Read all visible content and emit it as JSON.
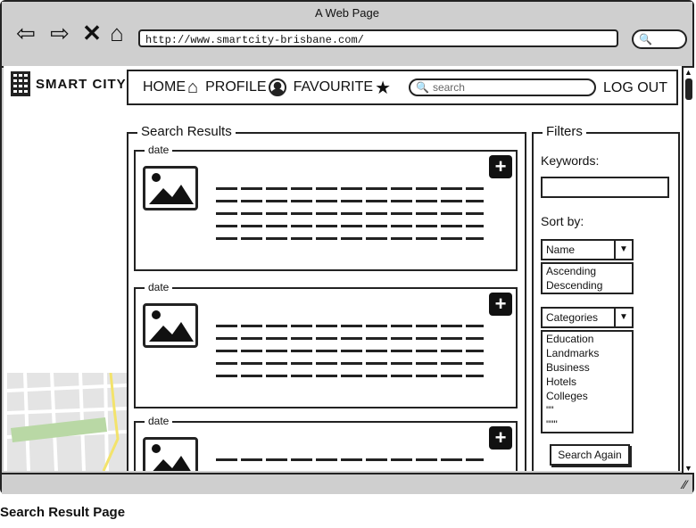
{
  "window": {
    "title": "A Web Page",
    "url": "http://www.smartcity-brisbane.com/"
  },
  "site": {
    "name": "SMART CITY"
  },
  "nav": {
    "items": [
      {
        "label": "HOME"
      },
      {
        "label": "PROFILE"
      },
      {
        "label": "FAVOURITE"
      }
    ],
    "search_placeholder": "search",
    "logout": "LOG OUT"
  },
  "results": {
    "title": "Search Results",
    "cards": [
      {
        "date": "date"
      },
      {
        "date": "date"
      },
      {
        "date": "date"
      }
    ]
  },
  "filters": {
    "title": "Filters",
    "keywords_label": "Keywords:",
    "sort_label": "Sort by:",
    "sort_selected": "Name",
    "sort_options": [
      "Ascending",
      "Descending"
    ],
    "category_selected": "Categories",
    "category_options": [
      "Education",
      "Landmarks",
      "Business",
      "Hotels",
      "Colleges",
      "\"\"",
      "\"\"\""
    ],
    "search_again": "Search Again"
  },
  "caption": "Search Result Page"
}
